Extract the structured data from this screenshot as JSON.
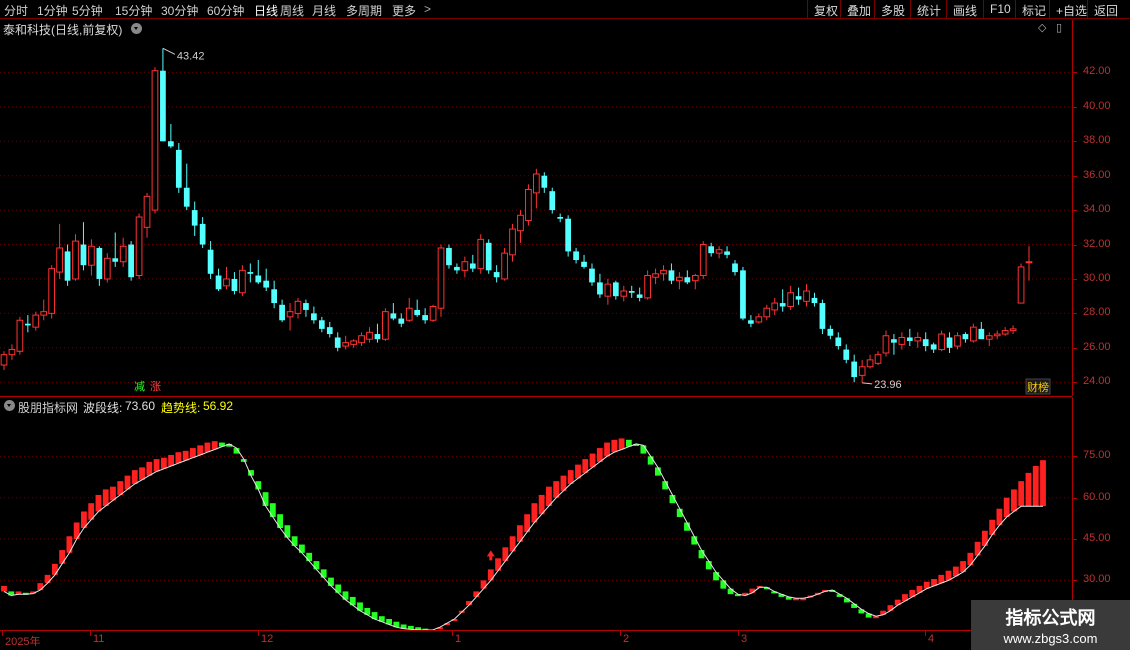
{
  "toolbar": {
    "periods": [
      "分时",
      "1分钟",
      "5分钟",
      "15分钟",
      "30分钟",
      "60分钟",
      "日线",
      "周线",
      "月线",
      "多周期",
      "更多"
    ],
    "active_period": "日线",
    "more_arrow": ">",
    "right_buttons": [
      "复权",
      "叠加",
      "多股",
      "统计",
      "画线",
      "F10",
      "标记",
      "+自选",
      "返回"
    ]
  },
  "main": {
    "stock_title": "泰和科技(日线,前复权)",
    "high_marker": "43.42",
    "low_marker": "23.96",
    "badge_decrease": "减",
    "badge_increase": "涨",
    "badge_finance": "财榜",
    "price_axis": [
      "42.00",
      "40.00",
      "38.00",
      "36.00",
      "34.00",
      "32.00",
      "30.00",
      "28.00",
      "26.00",
      "24.00"
    ],
    "price_range": [
      23.2,
      44.0
    ]
  },
  "indicator": {
    "site_name": "股朋指标网",
    "wave_label": "波段线:",
    "wave_value": "73.60",
    "trend_label": "趋势线:",
    "trend_value": "56.92",
    "axis": [
      "75.00",
      "60.00",
      "45.00",
      "30.00"
    ],
    "range": [
      12,
      90
    ]
  },
  "date_axis": {
    "labels": [
      "2025年",
      "11",
      "12",
      "1",
      "2",
      "3",
      "4"
    ]
  },
  "watermark": {
    "title": "指标公式网",
    "url": "www.zbgs3.com"
  },
  "colors": {
    "up": "#ff3232",
    "down": "#54ffff",
    "ind_up": "#ff2020",
    "ind_down": "#22ff22",
    "trend_value": "#ffff00",
    "axis": "#c03030",
    "grid": "#6a0000"
  },
  "chart_data": {
    "type": "candlestick",
    "title": "泰和科技(日线,前复权)",
    "high_label": 43.42,
    "low_label": 23.96,
    "candles": [
      [
        25.0,
        25.8,
        24.7,
        25.6
      ],
      [
        25.6,
        26.2,
        25.3,
        25.9
      ],
      [
        25.8,
        27.8,
        25.6,
        27.6
      ],
      [
        27.4,
        27.9,
        26.9,
        27.3
      ],
      [
        27.2,
        28.1,
        27.0,
        27.9
      ],
      [
        27.9,
        28.8,
        27.6,
        28.1
      ],
      [
        28.0,
        30.8,
        27.7,
        30.6
      ],
      [
        30.4,
        33.2,
        30.0,
        31.8
      ],
      [
        31.6,
        32.0,
        29.6,
        29.9
      ],
      [
        30.0,
        32.6,
        29.9,
        32.2
      ],
      [
        32.0,
        33.3,
        30.5,
        30.8
      ],
      [
        30.8,
        32.3,
        30.2,
        31.9
      ],
      [
        31.8,
        31.9,
        29.6,
        30.0
      ],
      [
        30.0,
        31.5,
        29.8,
        31.2
      ],
      [
        31.2,
        32.7,
        30.7,
        31.0
      ],
      [
        31.0,
        32.4,
        30.7,
        31.9
      ],
      [
        32.0,
        32.2,
        29.9,
        30.1
      ],
      [
        30.2,
        33.8,
        30.0,
        33.6
      ],
      [
        33.0,
        35.0,
        32.4,
        34.8
      ],
      [
        34.0,
        42.3,
        33.8,
        42.1
      ],
      [
        42.1,
        43.4,
        38.0,
        38.0
      ],
      [
        38.0,
        39.0,
        37.6,
        37.7
      ],
      [
        37.5,
        37.9,
        35.0,
        35.3
      ],
      [
        35.3,
        36.7,
        34.0,
        34.2
      ],
      [
        34.0,
        34.5,
        32.5,
        33.1
      ],
      [
        33.2,
        33.6,
        31.8,
        32.0
      ],
      [
        31.7,
        32.2,
        30.0,
        30.3
      ],
      [
        30.2,
        30.6,
        29.3,
        29.4
      ],
      [
        29.6,
        30.7,
        29.4,
        30.0
      ],
      [
        30.0,
        30.4,
        29.1,
        29.3
      ],
      [
        29.2,
        30.8,
        29.0,
        30.5
      ],
      [
        30.4,
        30.9,
        29.8,
        30.3
      ],
      [
        30.2,
        31.1,
        29.7,
        29.8
      ],
      [
        29.9,
        30.6,
        29.3,
        29.5
      ],
      [
        29.4,
        29.9,
        28.3,
        28.6
      ],
      [
        28.5,
        28.8,
        27.5,
        27.6
      ],
      [
        27.8,
        28.6,
        27.0,
        28.1
      ],
      [
        28.0,
        28.9,
        27.7,
        28.7
      ],
      [
        28.6,
        28.8,
        27.8,
        28.2
      ],
      [
        28.0,
        28.4,
        27.4,
        27.6
      ],
      [
        27.6,
        27.8,
        26.9,
        27.1
      ],
      [
        27.2,
        27.5,
        26.6,
        26.8
      ],
      [
        26.6,
        26.9,
        25.8,
        26.0
      ],
      [
        26.1,
        26.7,
        25.9,
        26.3
      ],
      [
        26.2,
        26.5,
        26.0,
        26.4
      ],
      [
        26.3,
        26.9,
        26.1,
        26.7
      ],
      [
        26.5,
        27.2,
        26.3,
        26.9
      ],
      [
        26.8,
        27.4,
        26.3,
        26.5
      ],
      [
        26.5,
        28.3,
        26.4,
        28.1
      ],
      [
        28.0,
        28.6,
        27.6,
        27.7
      ],
      [
        27.7,
        28.0,
        27.2,
        27.4
      ],
      [
        27.6,
        28.9,
        27.5,
        28.3
      ],
      [
        28.2,
        28.8,
        27.8,
        27.9
      ],
      [
        27.9,
        28.3,
        27.4,
        27.6
      ],
      [
        27.6,
        28.5,
        27.5,
        28.4
      ],
      [
        28.3,
        32.0,
        27.8,
        31.8
      ],
      [
        31.8,
        32.0,
        30.6,
        30.8
      ],
      [
        30.7,
        30.9,
        30.3,
        30.5
      ],
      [
        30.5,
        31.3,
        30.1,
        31.0
      ],
      [
        30.9,
        31.4,
        30.4,
        30.6
      ],
      [
        30.6,
        32.6,
        30.3,
        32.3
      ],
      [
        32.1,
        32.3,
        30.3,
        30.5
      ],
      [
        30.4,
        30.8,
        29.8,
        30.1
      ],
      [
        30.0,
        31.8,
        29.9,
        31.5
      ],
      [
        31.4,
        33.2,
        31.0,
        32.9
      ],
      [
        32.8,
        34.0,
        32.1,
        33.7
      ],
      [
        33.4,
        35.5,
        33.1,
        35.2
      ],
      [
        35.0,
        36.4,
        34.1,
        36.1
      ],
      [
        36.0,
        36.2,
        35.0,
        35.3
      ],
      [
        35.1,
        35.3,
        33.8,
        34.0
      ],
      [
        33.6,
        33.8,
        33.3,
        33.5
      ],
      [
        33.5,
        33.7,
        31.3,
        31.6
      ],
      [
        31.6,
        31.8,
        30.9,
        31.1
      ],
      [
        31.0,
        31.4,
        30.6,
        30.7
      ],
      [
        30.6,
        30.9,
        29.6,
        29.8
      ],
      [
        29.8,
        30.3,
        28.9,
        29.1
      ],
      [
        29.0,
        30.0,
        28.5,
        29.7
      ],
      [
        29.8,
        29.9,
        28.8,
        29.0
      ],
      [
        29.0,
        29.6,
        28.7,
        29.3
      ],
      [
        29.3,
        29.6,
        28.9,
        29.2
      ],
      [
        29.1,
        29.5,
        28.7,
        28.9
      ],
      [
        28.9,
        30.5,
        28.8,
        30.2
      ],
      [
        30.1,
        30.6,
        29.7,
        30.3
      ],
      [
        30.3,
        30.8,
        29.9,
        30.5
      ],
      [
        30.5,
        30.9,
        29.7,
        29.9
      ],
      [
        29.9,
        30.4,
        29.4,
        30.1
      ],
      [
        30.1,
        30.5,
        29.7,
        29.8
      ],
      [
        29.9,
        30.3,
        29.4,
        30.2
      ],
      [
        30.2,
        32.2,
        30.0,
        32.0
      ],
      [
        31.9,
        32.1,
        31.3,
        31.5
      ],
      [
        31.5,
        31.9,
        31.2,
        31.7
      ],
      [
        31.6,
        31.9,
        31.2,
        31.4
      ],
      [
        30.9,
        31.1,
        30.2,
        30.4
      ],
      [
        30.5,
        30.7,
        27.6,
        27.7
      ],
      [
        27.6,
        27.9,
        27.2,
        27.4
      ],
      [
        27.5,
        28.0,
        27.4,
        27.8
      ],
      [
        27.8,
        28.5,
        27.6,
        28.3
      ],
      [
        28.2,
        28.9,
        27.9,
        28.6
      ],
      [
        28.6,
        29.4,
        28.1,
        28.4
      ],
      [
        28.4,
        29.6,
        28.2,
        29.2
      ],
      [
        29.0,
        29.5,
        28.5,
        28.8
      ],
      [
        28.7,
        29.7,
        28.4,
        29.3
      ],
      [
        28.9,
        29.2,
        28.4,
        28.6
      ],
      [
        28.6,
        28.8,
        26.8,
        27.1
      ],
      [
        27.1,
        27.3,
        26.5,
        26.7
      ],
      [
        26.6,
        26.9,
        25.9,
        26.1
      ],
      [
        25.9,
        26.2,
        25.1,
        25.3
      ],
      [
        25.2,
        25.6,
        24.0,
        24.3
      ],
      [
        24.4,
        25.3,
        23.96,
        24.9
      ],
      [
        24.9,
        25.6,
        24.8,
        25.3
      ],
      [
        25.1,
        25.8,
        25.0,
        25.6
      ],
      [
        25.7,
        27.0,
        25.5,
        26.7
      ],
      [
        26.5,
        26.8,
        25.6,
        26.3
      ],
      [
        26.2,
        26.9,
        25.9,
        26.6
      ],
      [
        26.6,
        27.1,
        26.1,
        26.4
      ],
      [
        26.4,
        26.9,
        26.0,
        26.6
      ],
      [
        26.5,
        26.9,
        25.8,
        26.1
      ],
      [
        26.2,
        26.3,
        25.7,
        25.9
      ],
      [
        25.9,
        27.0,
        25.8,
        26.8
      ],
      [
        26.6,
        26.9,
        25.7,
        26.0
      ],
      [
        26.1,
        26.9,
        25.9,
        26.7
      ],
      [
        26.8,
        26.9,
        26.3,
        26.5
      ],
      [
        26.4,
        27.4,
        26.3,
        27.2
      ],
      [
        27.1,
        27.5,
        26.8,
        26.5
      ],
      [
        26.5,
        26.9,
        26.1,
        26.7
      ],
      [
        26.7,
        27.0,
        26.5,
        26.8
      ],
      [
        26.8,
        27.2,
        26.7,
        27.0
      ],
      [
        27.0,
        27.3,
        26.8,
        27.1
      ],
      [
        28.6,
        30.9,
        28.6,
        30.7
      ],
      [
        31.0,
        31.9,
        29.9,
        31.0
      ]
    ],
    "x_labels": [
      "2025年",
      "11",
      "12",
      "1",
      "2",
      "3",
      "4"
    ],
    "y_range": [
      23.2,
      44.0
    ],
    "indicator": {
      "name": "股朋指标网",
      "series": [
        {
          "name": "波段线",
          "last": 73.6
        },
        {
          "name": "趋势线",
          "last": 56.92
        }
      ],
      "wave": [
        28.0,
        26.0,
        26.0,
        25.5,
        26.0,
        29.0,
        32.0,
        36.0,
        41.0,
        46.0,
        51.0,
        55.0,
        58.0,
        61.0,
        63.0,
        64.0,
        66.0,
        68.0,
        70.0,
        71.0,
        73.0,
        74.0,
        74.5,
        75.5,
        76.5,
        77.0,
        78.0,
        79.0,
        80.0,
        80.5,
        80.0,
        78.5,
        76.0,
        73.0,
        70.0,
        66.0,
        62.0,
        58.0,
        54.0,
        50.0,
        46.0,
        43.0,
        40.0,
        37.0,
        34.0,
        31.0,
        28.5,
        26.0,
        24.0,
        22.0,
        20.0,
        18.5,
        17.0,
        16.0,
        15.0,
        14.0,
        13.5,
        13.0,
        12.5,
        12.0,
        12.5,
        14.0,
        16.0,
        19.0,
        22.5,
        26.0,
        30.0,
        34.0,
        38.0,
        42.0,
        46.0,
        50.0,
        54.0,
        58.0,
        61.0,
        64.0,
        66.0,
        68.0,
        70.0,
        72.0,
        74.0,
        76.0,
        78.0,
        80.0,
        81.0,
        81.5,
        81.0,
        79.0,
        76.0,
        72.0,
        68.0,
        63.0,
        58.0,
        53.0,
        48.0,
        43.0,
        38.0,
        34.0,
        30.0,
        27.0,
        25.0,
        24.5,
        25.5,
        27.0,
        28.0,
        27.0,
        25.5,
        24.0,
        23.0,
        23.0,
        23.5,
        24.5,
        25.5,
        26.5,
        26.0,
        24.0,
        22.0,
        20.0,
        18.0,
        16.5,
        17.0,
        19.0,
        21.0,
        23.0,
        25.0,
        26.5,
        28.0,
        29.5,
        30.5,
        32.0,
        33.5,
        35.0,
        37.0,
        40.0,
        44.0,
        48.0,
        52.0,
        56.0,
        60.0,
        63.0,
        66.0,
        69.0,
        71.5,
        73.6
      ],
      "trend": [
        26.0,
        24.5,
        25.0,
        25.0,
        25.2,
        26.5,
        29.0,
        32.0,
        36.0,
        40.0,
        45.0,
        49.0,
        52.0,
        55.0,
        57.0,
        59.0,
        61.0,
        63.0,
        65.0,
        66.5,
        68.0,
        69.5,
        70.5,
        71.5,
        72.5,
        73.5,
        74.5,
        75.5,
        76.5,
        77.5,
        78.5,
        79.5,
        78.0,
        74.0,
        68.0,
        63.0,
        57.0,
        53.0,
        49.0,
        45.5,
        42.5,
        40.0,
        37.0,
        34.0,
        31.0,
        28.0,
        25.5,
        23.0,
        21.0,
        19.0,
        17.5,
        16.0,
        15.0,
        14.0,
        13.0,
        12.5,
        12.2,
        12.0,
        12.0,
        12.0,
        13.0,
        14.5,
        16.0,
        18.5,
        21.0,
        24.0,
        27.0,
        30.0,
        33.5,
        37.0,
        40.5,
        44.0,
        47.5,
        51.0,
        54.0,
        57.0,
        60.0,
        62.5,
        65.0,
        67.0,
        69.0,
        71.0,
        73.0,
        75.0,
        76.5,
        77.5,
        78.5,
        79.5,
        79.0,
        75.0,
        71.0,
        66.0,
        61.0,
        56.0,
        51.0,
        46.0,
        41.0,
        37.0,
        33.0,
        30.0,
        27.0,
        25.0,
        24.5,
        25.5,
        27.5,
        27.5,
        26.0,
        25.0,
        24.0,
        23.5,
        23.5,
        24.0,
        25.0,
        26.0,
        26.5,
        25.0,
        23.5,
        21.5,
        19.5,
        18.0,
        17.0,
        17.5,
        19.0,
        21.0,
        22.5,
        24.0,
        25.5,
        27.0,
        28.0,
        29.0,
        30.0,
        31.5,
        33.0,
        35.5,
        39.0,
        42.5,
        46.5,
        50.0,
        53.0,
        55.0,
        56.92,
        56.92,
        56.92,
        56.92
      ],
      "signals": [
        67,
        158
      ]
    }
  }
}
